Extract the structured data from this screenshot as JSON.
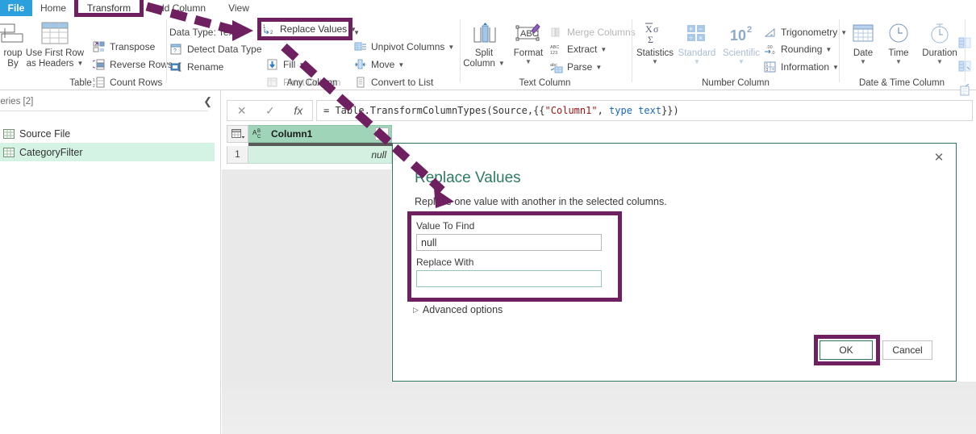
{
  "ribbon": {
    "tabs": [
      {
        "label": "File",
        "name": "tab-file"
      },
      {
        "label": "Home",
        "name": "tab-home"
      },
      {
        "label": "Transform",
        "name": "tab-transform"
      },
      {
        "label": "Add Column",
        "name": "tab-add-column"
      },
      {
        "label": "View",
        "name": "tab-view"
      }
    ],
    "groups": [
      {
        "label": "Table"
      },
      {
        "label": "Any Column"
      },
      {
        "label": "Text Column"
      },
      {
        "label": "Number Column"
      },
      {
        "label": "Date & Time Column"
      }
    ],
    "table_group": {
      "group_by": "Group\nBy",
      "group_by_line1": "roup",
      "group_by_line2": "By",
      "use_first_row_line1": "Use First Row",
      "use_first_row_line2": "as Headers",
      "items": [
        {
          "label": "Transpose",
          "icon": "transpose-icon",
          "disabled": false,
          "caret": false
        },
        {
          "label": "Reverse Rows",
          "icon": "reverse-rows-icon",
          "disabled": false,
          "caret": false
        },
        {
          "label": "Count Rows",
          "icon": "count-rows-icon",
          "disabled": false,
          "caret": false
        }
      ]
    },
    "any_column_group": {
      "data_type": "Data Type: Text",
      "items": [
        {
          "label": "Detect Data Type",
          "icon": "detect-data-type-icon",
          "disabled": false,
          "caret": false
        },
        {
          "label": "Rename",
          "icon": "rename-icon",
          "disabled": false,
          "caret": false
        },
        {
          "label": "Replace Values",
          "icon": "replace-values-icon",
          "disabled": false,
          "caret": true
        },
        {
          "label": "Fill",
          "icon": "fill-icon",
          "disabled": false,
          "caret": true
        },
        {
          "label": "Pivot Column",
          "icon": "pivot-column-icon",
          "disabled": true,
          "caret": false
        },
        {
          "label": "Unpivot Columns",
          "icon": "unpivot-columns-icon",
          "disabled": false,
          "caret": true
        },
        {
          "label": "Move",
          "icon": "move-icon",
          "disabled": false,
          "caret": true
        },
        {
          "label": "Convert to List",
          "icon": "convert-to-list-icon",
          "disabled": false,
          "caret": false
        }
      ]
    },
    "text_column_group": {
      "split_column_line1": "Split",
      "split_column_line2": "Column",
      "format": "Format",
      "items": [
        {
          "label": "Merge Columns",
          "icon": "merge-columns-icon",
          "disabled": true,
          "caret": false
        },
        {
          "label": "Extract",
          "icon": "extract-icon",
          "disabled": false,
          "caret": true
        },
        {
          "label": "Parse",
          "icon": "parse-icon",
          "disabled": false,
          "caret": true
        }
      ]
    },
    "number_column_group": {
      "statistics": "Statistics",
      "standard": "Standard",
      "scientific": "Scientific",
      "items": [
        {
          "label": "Trigonometry",
          "icon": "trigonometry-icon",
          "disabled": false,
          "caret": true
        },
        {
          "label": "Rounding",
          "icon": "rounding-icon",
          "disabled": false,
          "caret": true
        },
        {
          "label": "Information",
          "icon": "information-icon",
          "disabled": false,
          "caret": true
        }
      ]
    },
    "datetime_column_group": {
      "date": "Date",
      "time": "Time",
      "duration": "Duration"
    }
  },
  "queries": {
    "header": "ueries [2]",
    "collapse_icon": "chevron-left-icon",
    "items": [
      {
        "label": "Source File",
        "selected": false
      },
      {
        "label": "CategoryFilter",
        "selected": true
      }
    ]
  },
  "formula_bar": {
    "cancel_icon": "cancel-icon",
    "accept_icon": "checkmark-icon",
    "fx_icon": "fx-icon",
    "prefix": "= Table.TransformColumnTypes(Source,{{",
    "string_token": "\"Column1\"",
    "comma": ", ",
    "keyword_token": "type text",
    "suffix": "}})"
  },
  "grid": {
    "corner_icon": "select-all-icon",
    "column_header": "Column1",
    "column_type_icon": "ABC",
    "filter_icon": "chevron-down-icon",
    "rows": [
      {
        "num": "1",
        "value": "null"
      }
    ]
  },
  "dialog": {
    "close_icon": "close-icon",
    "title": "Replace Values",
    "subtitle": "Replace one value with another in the selected columns.",
    "value_to_find_label": "Value To Find",
    "value_to_find_value": "null",
    "replace_with_label": "Replace With",
    "replace_with_value": "",
    "advanced_options": "Advanced options",
    "advanced_icon": "triangle-right-icon",
    "ok_label": "OK",
    "cancel_label": "Cancel"
  },
  "colors": {
    "file_tab_blue": "#2c9fdd",
    "annotation_purple": "#6e2060",
    "dialog_teal": "#2f7560",
    "title_teal": "#2f7a63",
    "selection_green": "#d4f3e4",
    "header_green": "#9fd4b9"
  }
}
